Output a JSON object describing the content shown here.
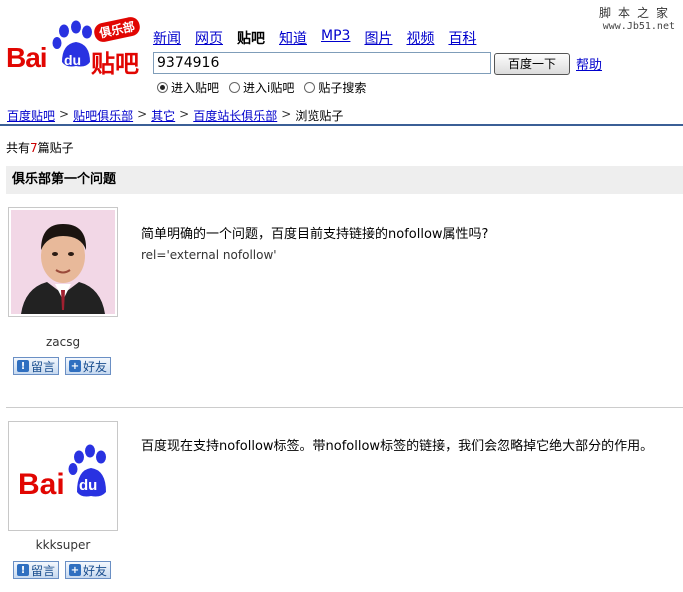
{
  "logo": {
    "text_bai": "Bai",
    "text_du": "du",
    "text_tieba": "贴吧",
    "badge": "俱乐部"
  },
  "watermark": {
    "title": "脚本之家",
    "url": "www.Jb51.net"
  },
  "nav": [
    {
      "label": "新闻",
      "current": false
    },
    {
      "label": "网页",
      "current": false
    },
    {
      "label": "贴吧",
      "current": true
    },
    {
      "label": "知道",
      "current": false
    },
    {
      "label": "MP3",
      "current": false
    },
    {
      "label": "图片",
      "current": false
    },
    {
      "label": "视频",
      "current": false
    },
    {
      "label": "百科",
      "current": false
    }
  ],
  "search": {
    "value": "9374916",
    "button": "百度一下",
    "help": "帮助"
  },
  "radios": [
    {
      "label": "进入贴吧",
      "checked": true
    },
    {
      "label": "进入i贴吧",
      "checked": false
    },
    {
      "label": "贴子搜索",
      "checked": false
    }
  ],
  "breadcrumbs": {
    "items": [
      "百度贴吧",
      "贴吧俱乐部",
      "其它",
      "百度站长俱乐部"
    ],
    "current": "浏览贴子",
    "separator": ">"
  },
  "count": {
    "prefix": "共有",
    "num": "7",
    "suffix": "篇贴子"
  },
  "thread_title": "俱乐部第一个问题",
  "posts": [
    {
      "username": "zacsg",
      "avatar": "portrait-photo",
      "text": "简单明确的一个问题，百度目前支持链接的nofollow属性吗?",
      "subtext": "rel='external nofollow'",
      "msg_button": "留言",
      "friend_button": "好友"
    },
    {
      "username": "kkksuper",
      "avatar": "baidu-logo",
      "text": "百度现在支持nofollow标签。带nofollow标签的链接，我们会忽略掉它绝大部分的作用。",
      "subtext": "",
      "msg_button": "留言",
      "friend_button": "好友"
    }
  ],
  "colors": {
    "brand_red": "#e10602",
    "brand_blue": "#2932e1",
    "link": "#0000cc",
    "rule": "#3b5f96"
  }
}
